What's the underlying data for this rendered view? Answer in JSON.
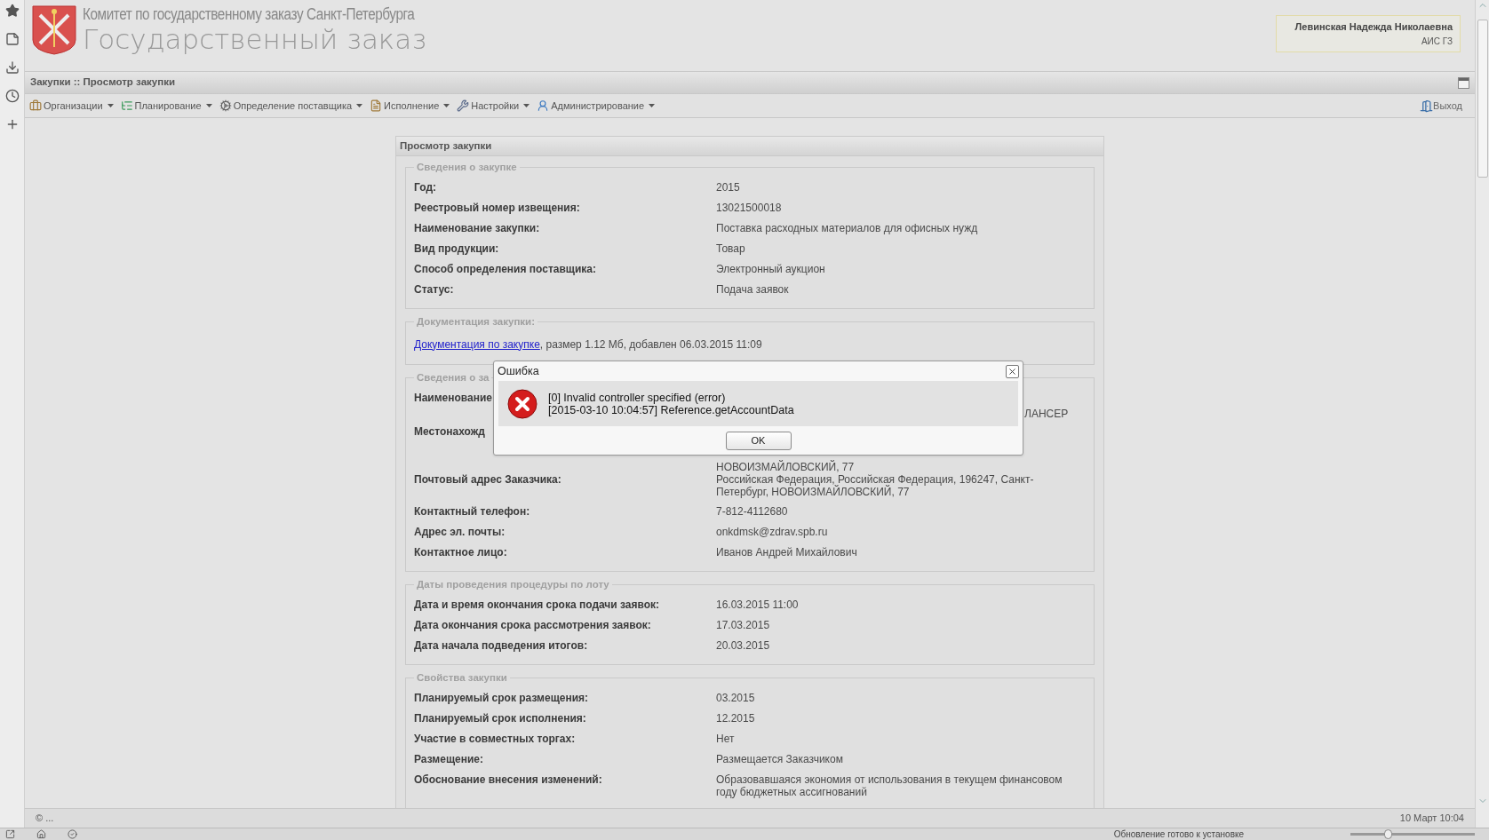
{
  "header": {
    "subtitle": "Комитет по государственному заказу Санкт-Петербурга",
    "title": "Государственный заказ"
  },
  "user": {
    "name": "Левинская Надежда Николаевна",
    "system": "АИС ГЗ"
  },
  "breadcrumb": "Закупки :: Просмотр закупки",
  "menu": [
    {
      "label": "Организации",
      "kind": "briefcase"
    },
    {
      "label": "Планирование",
      "kind": "list"
    },
    {
      "label": "Определение поставщика",
      "kind": "cogs"
    },
    {
      "label": "Исполнение",
      "kind": "docs"
    },
    {
      "label": "Настройки",
      "kind": "wrench"
    },
    {
      "label": "Администрирование",
      "kind": "user"
    }
  ],
  "logout": "Выход",
  "panel": {
    "title": "Просмотр закупки",
    "sections": [
      {
        "kind": "rows",
        "legend": "Сведения о закупке",
        "rows": [
          {
            "label": "Год:",
            "value": "2015"
          },
          {
            "label": "Реестровый номер извещения:",
            "value": "13021500018"
          },
          {
            "label": "Наименование закупки:",
            "value": "Поставка расходных материалов для офисных нужд"
          },
          {
            "label": "Вид продукции:",
            "value": "Товар"
          },
          {
            "label": "Способ определения поставщика:",
            "value": "Электронный аукцион"
          },
          {
            "label": "Статус:",
            "value": "Подача заявок"
          }
        ]
      },
      {
        "kind": "doc",
        "legend": "Документация закупки:",
        "link": "Документация по закупке",
        "text": ", размер 1.12 Мб, добавлен 06.03.2015 11:09"
      },
      {
        "kind": "rows",
        "legend": "Сведения о за",
        "rows": [
          {
            "label": "Наименование",
            "value": "ЛАНСЕР",
            "kind": "tail"
          },
          {
            "label": "Местонахожд",
            "value": "НОВОИЗМАЙЛОВСКИЙ, 77",
            "kind": "under"
          },
          {
            "label": "Почтовый адрес Заказчика:",
            "value": "Российская Федерация, Российская Федерация, 196247, Санкт-Петербург, НОВОИЗМАЙЛОВСКИЙ, 77"
          },
          {
            "label": "Контактный телефон:",
            "value": "7-812-4112680"
          },
          {
            "label": "Адрес эл. почты:",
            "value": "onkdmsk@zdrav.spb.ru"
          },
          {
            "label": "Контактное лицо:",
            "value": "Иванов Андрей Михайлович"
          }
        ]
      },
      {
        "kind": "rows",
        "legend": "Даты проведения процедуры по лоту",
        "rows": [
          {
            "label": "Дата и время окончания срока подачи заявок:",
            "value": "16.03.2015 11:00"
          },
          {
            "label": "Дата окончания срока рассмотрения заявок:",
            "value": "17.03.2015"
          },
          {
            "label": "Дата начала подведения итогов:",
            "value": "20.03.2015"
          }
        ]
      },
      {
        "kind": "rows",
        "legend": "Свойства закупки",
        "rows": [
          {
            "label": "Планируемый срок размещения:",
            "value": "03.2015"
          },
          {
            "label": "Планируемый срок исполнения:",
            "value": "12.2015"
          },
          {
            "label": "Участие в совместных торгах:",
            "value": "Нет"
          },
          {
            "label": "Размещение:",
            "value": "Размещается Заказчиком"
          },
          {
            "label": "Обоснование внесения изменений:",
            "value": "Образовавшаяся экономия от использования в текущем финансовом году бюджетных ассигнований"
          }
        ]
      }
    ]
  },
  "dialog": {
    "title": "Ошибка",
    "lines": [
      "[0] Invalid controller specified (error)",
      "[2015-03-10 10:04:57] Reference.getAccountData"
    ],
    "button": "OK"
  },
  "status_bar": {
    "left": "© ...",
    "right": "10 Март 10:04"
  },
  "taskbar": {
    "notice": "Обновление готово к установке",
    "zoom": {
      "level": 0.3
    }
  }
}
